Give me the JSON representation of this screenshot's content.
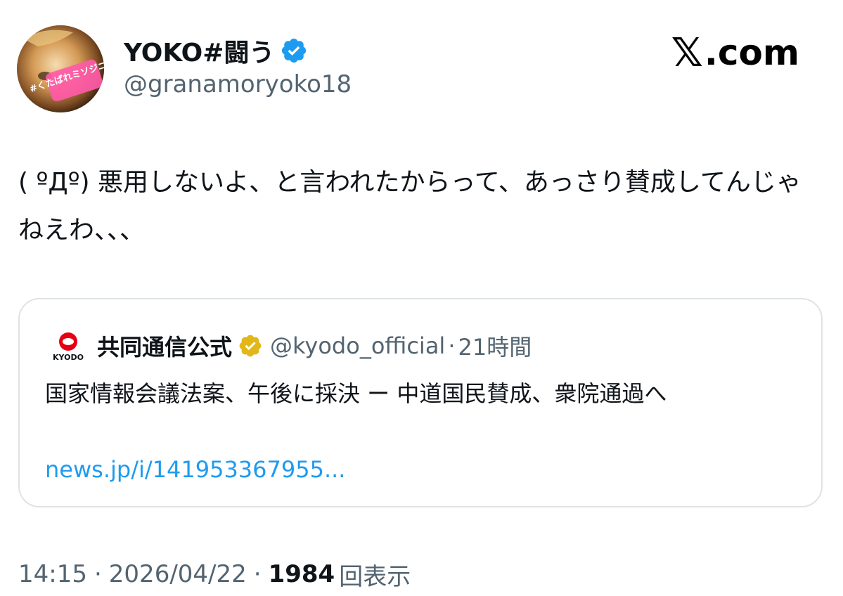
{
  "author": {
    "display_name": "YOKO#闘う",
    "handle": "@granamoryoko18",
    "verified_icon": "verified-badge-blue-icon",
    "avatar_text": "#くたばれミソジニー"
  },
  "brand": {
    "label": ".com",
    "logo_icon": "x-logo-icon"
  },
  "tweet": {
    "text": "( ºДº) 悪用しないよ、と言われたからって、あっさり賛成してんじゃねえわ、、、"
  },
  "quote": {
    "logo_text": "KYODO",
    "display_name": "共同通信公式",
    "verified_icon": "verified-badge-gold-icon",
    "handle": "@kyodo_official",
    "separator": "·",
    "time": "21時間",
    "text": "国家情報会議法案、午後に採決 ー 中道国民賛成、衆院通過へ",
    "link": "news.jp/i/141953367955..."
  },
  "meta": {
    "time": "14:15",
    "separator": "·",
    "date": "2026/04/22",
    "views_count": "1984",
    "views_label": "回表示"
  },
  "colors": {
    "text_primary": "#0f1419",
    "text_secondary": "#536471",
    "link": "#1d9bf0",
    "verified_blue": "#1d9bf0",
    "verified_gold": "#e2b719",
    "kyodo_red": "#e60012",
    "border": "#dfe3e6"
  }
}
